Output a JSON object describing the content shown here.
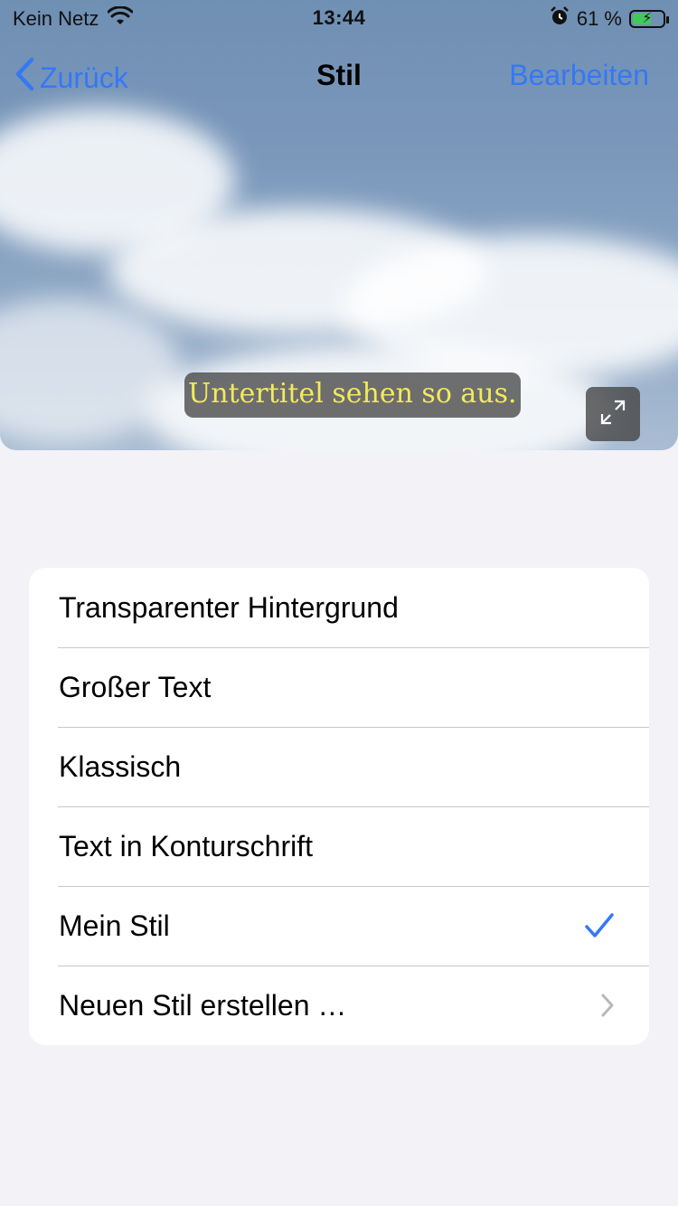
{
  "status_bar": {
    "carrier": "Kein Netz",
    "time": "13:44",
    "battery_percent": "61 %",
    "battery_level": 0.61
  },
  "nav": {
    "back_label": "Zurück",
    "title": "Stil",
    "edit_label": "Bearbeiten"
  },
  "preview": {
    "subtitle_text": "Untertitel sehen so aus.",
    "expand_icon": "expand-icon"
  },
  "styles": {
    "items": [
      {
        "label": "Transparenter Hintergrund",
        "selected": false
      },
      {
        "label": "Großer Text",
        "selected": false
      },
      {
        "label": "Klassisch",
        "selected": false
      },
      {
        "label": "Text in Konturschrift",
        "selected": false
      },
      {
        "label": "Mein Stil",
        "selected": true
      },
      {
        "label": "Neuen Stil erstellen …",
        "disclosure": true
      }
    ]
  },
  "colors": {
    "accent": "#3478f6",
    "subtitle_text": "#f2ea5a",
    "background": "#f2f2f7"
  }
}
